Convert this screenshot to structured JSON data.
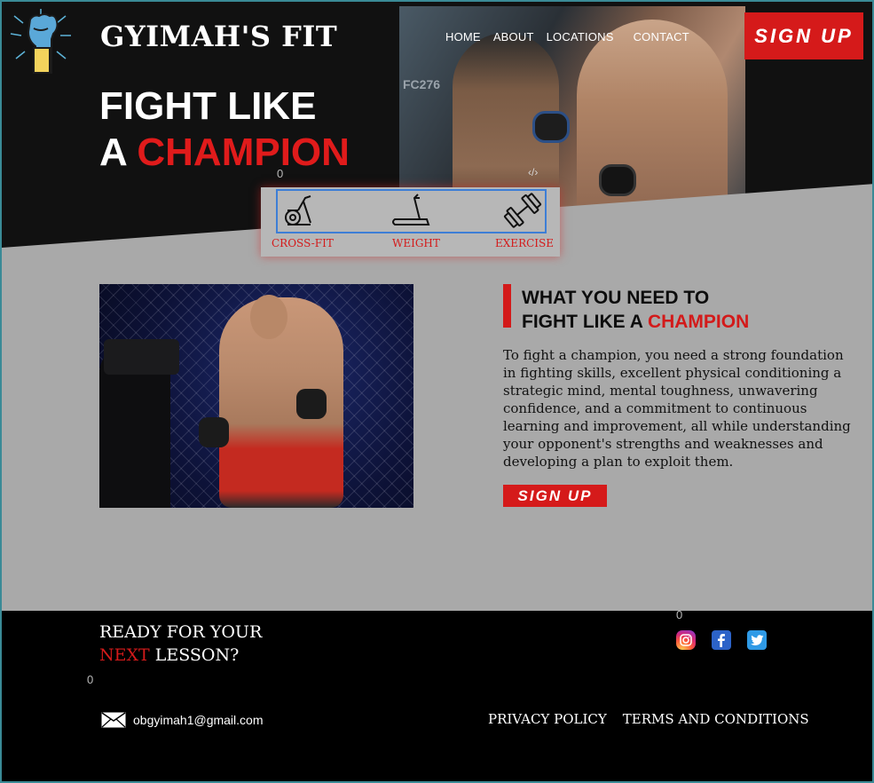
{
  "brand": {
    "name": "GYIMAH'S FIT"
  },
  "nav": {
    "home": "HOME",
    "about": "ABOUT",
    "locations": "LOCATIONS",
    "contact": "CONTACT"
  },
  "header": {
    "signup_label": "SIGN UP"
  },
  "hero": {
    "headline_line1": "FIGHT LIKE",
    "headline_line2_prefix": "A ",
    "headline_line2_highlight": "CHAMPION",
    "photo_tag": "FC276",
    "code_icon": "‹/›"
  },
  "placeholders": {
    "zero_a": "0",
    "zero_b": "0",
    "zero_c": "0"
  },
  "categories": [
    {
      "label": "CROSS-FIT",
      "icon": "exercise-bike-icon"
    },
    {
      "label": "WEIGHT",
      "icon": "treadmill-icon"
    },
    {
      "label": "EXERCISE",
      "icon": "dumbbell-icon"
    }
  ],
  "about": {
    "title_line1": "WHAT YOU NEED TO",
    "title_line2_prefix": "FIGHT LIKE A ",
    "title_line2_highlight": "CHAMPION",
    "body": "To fight a champion, you need a strong foundation in fighting skills, excellent physical conditioning a strategic mind, mental toughness, unwavering confidence, and a commitment to continuous learning and improvement, all while understanding your opponent's strengths and weaknesses and developing a plan to exploit them.",
    "signup_label": "SIGN UP"
  },
  "footer": {
    "ready_line1": "READY FOR YOUR",
    "ready_highlight": "NEXT",
    "ready_line2_rest": " LESSON?",
    "email": "obgyimah1@gmail.com",
    "privacy": "PRIVACY POLICY",
    "terms": "TERMS AND CONDITIONS",
    "social": [
      "instagram-icon",
      "facebook-icon",
      "twitter-icon"
    ]
  },
  "colors": {
    "accent": "#d51a1a",
    "grey": "#a9a9a9",
    "dark": "#0c0c0c",
    "select_border": "#3d7ed6"
  }
}
